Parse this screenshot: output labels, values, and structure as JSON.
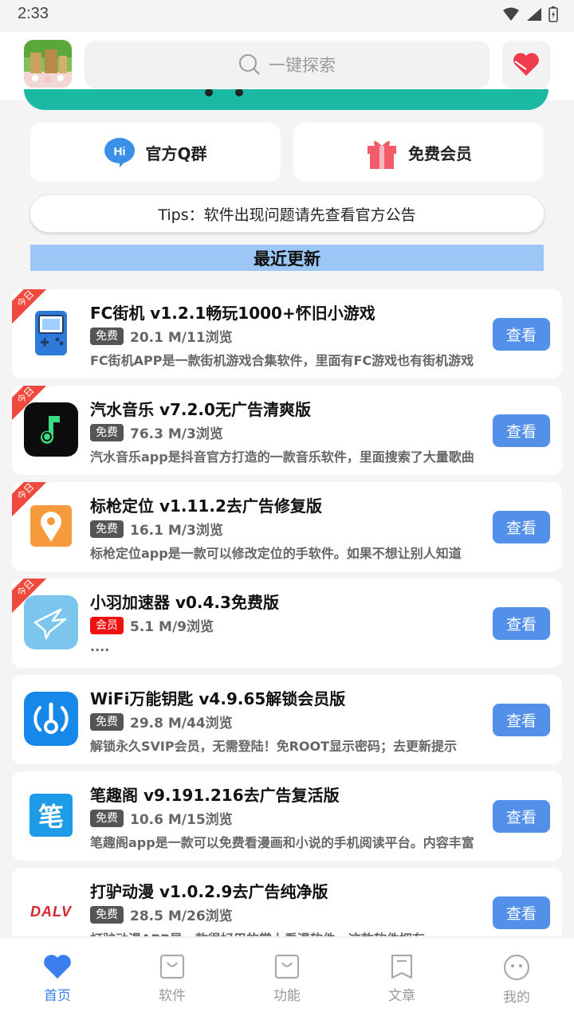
{
  "status": {
    "time": "2:33"
  },
  "search": {
    "placeholder": "一键探索"
  },
  "quick_links": [
    {
      "label": "官方Q群",
      "icon": "hi-chat-icon"
    },
    {
      "label": "免费会员",
      "icon": "gift-icon"
    }
  ],
  "tips": "Tips：软件出现问题请先查看官方公告",
  "section_title": "最近更新",
  "ribbon_label": "今日",
  "view_label": "查看",
  "apps": [
    {
      "title": "FC街机 v1.2.1畅玩1000+怀旧小游戏",
      "badge": "免费",
      "meta": "20.1 M/11浏览",
      "desc": "FC街机APP是一款街机游戏合集软件，里面有FC游戏也有街机游戏",
      "today": true,
      "icon": "gameboy-icon"
    },
    {
      "title": "汽水音乐 v7.2.0无广告清爽版",
      "badge": "免费",
      "meta": "76.3 M/3浏览",
      "desc": "汽水音乐app是抖音官方打造的一款音乐软件，里面搜索了大量歌曲",
      "today": true,
      "icon": "music-note-icon"
    },
    {
      "title": "标枪定位 v1.11.2去广告修复版",
      "badge": "免费",
      "meta": "16.1 M/3浏览",
      "desc": "标枪定位app是一款可以修改定位的手软件。如果不想让别人知道",
      "today": true,
      "icon": "location-pin-icon"
    },
    {
      "title": "小羽加速器 v0.4.3免费版",
      "badge": "会员",
      "meta": "5.1 M/9浏览",
      "desc": "....",
      "today": true,
      "vip": true,
      "icon": "bird-icon"
    },
    {
      "title": "WiFi万能钥匙 v4.9.65解锁会员版",
      "badge": "免费",
      "meta": "29.8 M/44浏览",
      "desc": "解锁永久SVIP会员，无需登陆！免ROOT显示密码；去更新提示",
      "today": false,
      "icon": "wifi-key-icon"
    },
    {
      "title": "笔趣阁 v9.191.216去广告复活版",
      "badge": "免费",
      "meta": "10.6 M/15浏览",
      "desc": "笔趣阁app是一款可以免费看漫画和小说的手机阅读平台。内容丰富",
      "today": false,
      "icon": "bi-character-icon",
      "icon_text": "笔"
    },
    {
      "title": "打驴动漫 v1.0.2.9去广告纯净版",
      "badge": "免费",
      "meta": "28.5 M/26浏览",
      "desc": "打驴动漫APP是一款很好用的掌上看漫软件，这款软件拥有",
      "today": false,
      "icon": "dalv-logo-icon",
      "icon_text": "DALV"
    }
  ],
  "nav": [
    {
      "label": "首页",
      "icon": "heart-icon",
      "active": true
    },
    {
      "label": "软件",
      "icon": "bag-icon"
    },
    {
      "label": "功能",
      "icon": "bag-icon"
    },
    {
      "label": "文章",
      "icon": "bookmark-icon"
    },
    {
      "label": "我的",
      "icon": "smiley-icon"
    }
  ],
  "colors": {
    "accent": "#5390e9",
    "ribbon": "#ef4a3d",
    "banner": "#1ab9a3",
    "section": "#9cc6f5"
  }
}
